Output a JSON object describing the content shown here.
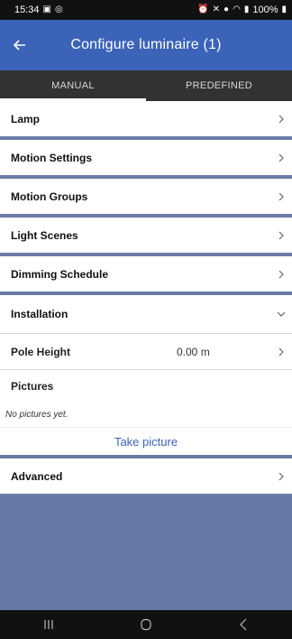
{
  "status": {
    "time": "15:34",
    "battery": "100%"
  },
  "app_bar": {
    "title": "Configure luminaire (1)"
  },
  "tabs": [
    {
      "label": "MANUAL",
      "active": true
    },
    {
      "label": "PREDEFINED",
      "active": false
    }
  ],
  "sections": {
    "lamp": "Lamp",
    "motion_settings": "Motion Settings",
    "motion_groups": "Motion Groups",
    "light_scenes": "Light Scenes",
    "dimming_schedule": "Dimming Schedule",
    "installation": "Installation",
    "advanced": "Advanced"
  },
  "installation": {
    "pole_height_label": "Pole Height",
    "pole_height_value": "0.00 m",
    "pictures_label": "Pictures",
    "pictures_empty": "No pictures yet.",
    "take_picture": "Take picture"
  },
  "icons": {
    "back": "arrow-left-icon",
    "chevron_right": "chevron-right-icon",
    "chevron_down": "chevron-down-icon"
  },
  "colors": {
    "primary": "#3b63b8",
    "tab_bar": "#323232",
    "divider": "#6b7aa6",
    "background": "#6878a4"
  }
}
